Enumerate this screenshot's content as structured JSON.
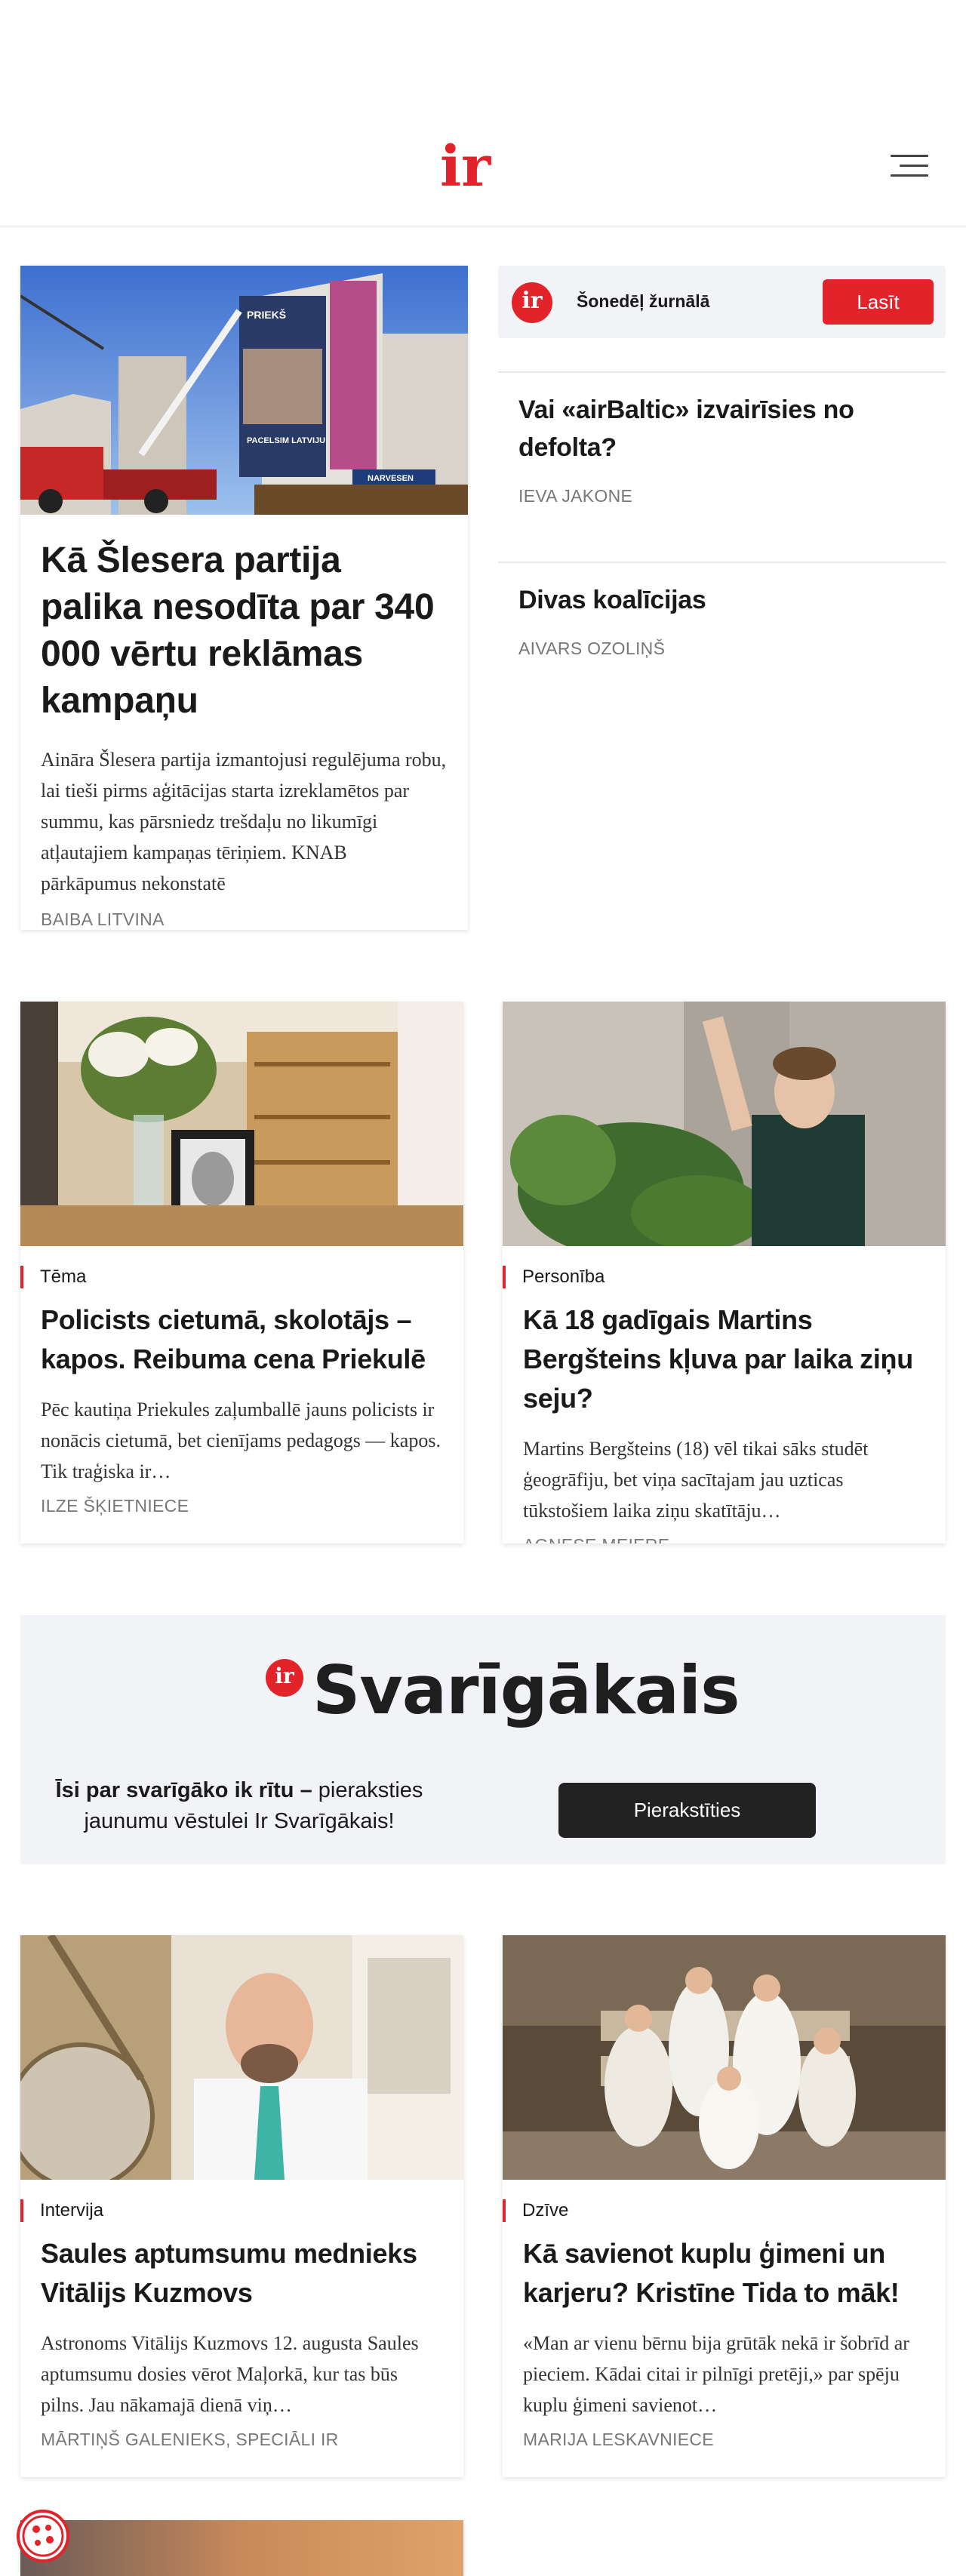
{
  "header": {
    "logo_text": "ir",
    "brand_color": "#e2232a",
    "menu_icon": "hamburger-menu-icon"
  },
  "featured": {
    "title": "Kā Šlesera partija palika nesodīta par 340 000 vērtu reklāmas kampaņu",
    "lead": "Aināra Šlesera partija izmantojusi regulējuma robu, lai tieši pirms aģitācijas starta izreklamētos par summu, kas pārsniedz trešdaļu no likumīgi atļautajiem kampaņas tēriņiem. KNAB pārkāpumus nekonstatē",
    "author": "BAIBA LITVINA",
    "billboard_text": [
      "PRIEKŠ",
      "PACELSIM LATVIJU",
      "NARVESEN"
    ]
  },
  "magazine": {
    "logo_text": "ir",
    "label": "Šonedēļ žurnālā",
    "button": "Lasīt"
  },
  "side_articles": [
    {
      "title": "Vai «airBaltic» izvairīsies no defolta?",
      "author": "IEVA JAKONE"
    },
    {
      "title": "Divas koalīcijas",
      "author": "AIVARS OZOLIŅŠ"
    }
  ],
  "row1": [
    {
      "tag": "Tēma",
      "title": "Policists cietumā, skolotājs – kapos. Reibuma cena Priekulē",
      "lead": "Pēc kautiņa Priekules zaļumballē jauns policists ir nonācis cietumā, bet cienījams pedagogs — kapos. Tik traģiska ir…",
      "author": "ILZE ŠĶIETNIECE"
    },
    {
      "tag": "Personība",
      "title": "Kā 18 gadīgais Martins Bergšteins kļuva par laika ziņu seju?",
      "lead": "Martins Bergšteins (18) vēl tikai sāks studēt ģeogrāfiju, bet viņa sacītajam jau uzticas tūkstošiem laika ziņu skatītāju…",
      "author": "AGNESE MEIERE"
    }
  ],
  "newsletter": {
    "logo_text": "ir",
    "name": "Svarīgākais",
    "text_bold": "Īsi par svarīgāko ik rītu –",
    "text_rest": " pieraksties jaunumu vēstulei Ir Svarīgākais!",
    "button": "Pierakstīties"
  },
  "row2": [
    {
      "tag": "Intervija",
      "title": "Saules aptumsumu mednieks Vitālijs Kuzmovs",
      "lead": "Astronoms Vitālijs Kuzmovs 12. augusta Saules aptumsumu dosies vērot Maļorkā, kur tas būs pilns. Jau nākamajā dienā viņ…",
      "author": "MĀRTIŅŠ GALENIEKS, SPECIĀLI IR"
    },
    {
      "tag": "Dzīve",
      "title": "Kā savienot kuplu ģimeni un karjeru? Kristīne Tida to māk!",
      "lead": "«Man ar vienu bērnu bija grūtāk nekā ir šobrīd ar pieciem. Kādai citai ir pilnīgi pretēji,» par spēju kuplu ģimeni savienot…",
      "author": "MARIJA LESKAVNIECE"
    }
  ],
  "cookie": {
    "icon": "cookie-settings-icon"
  }
}
